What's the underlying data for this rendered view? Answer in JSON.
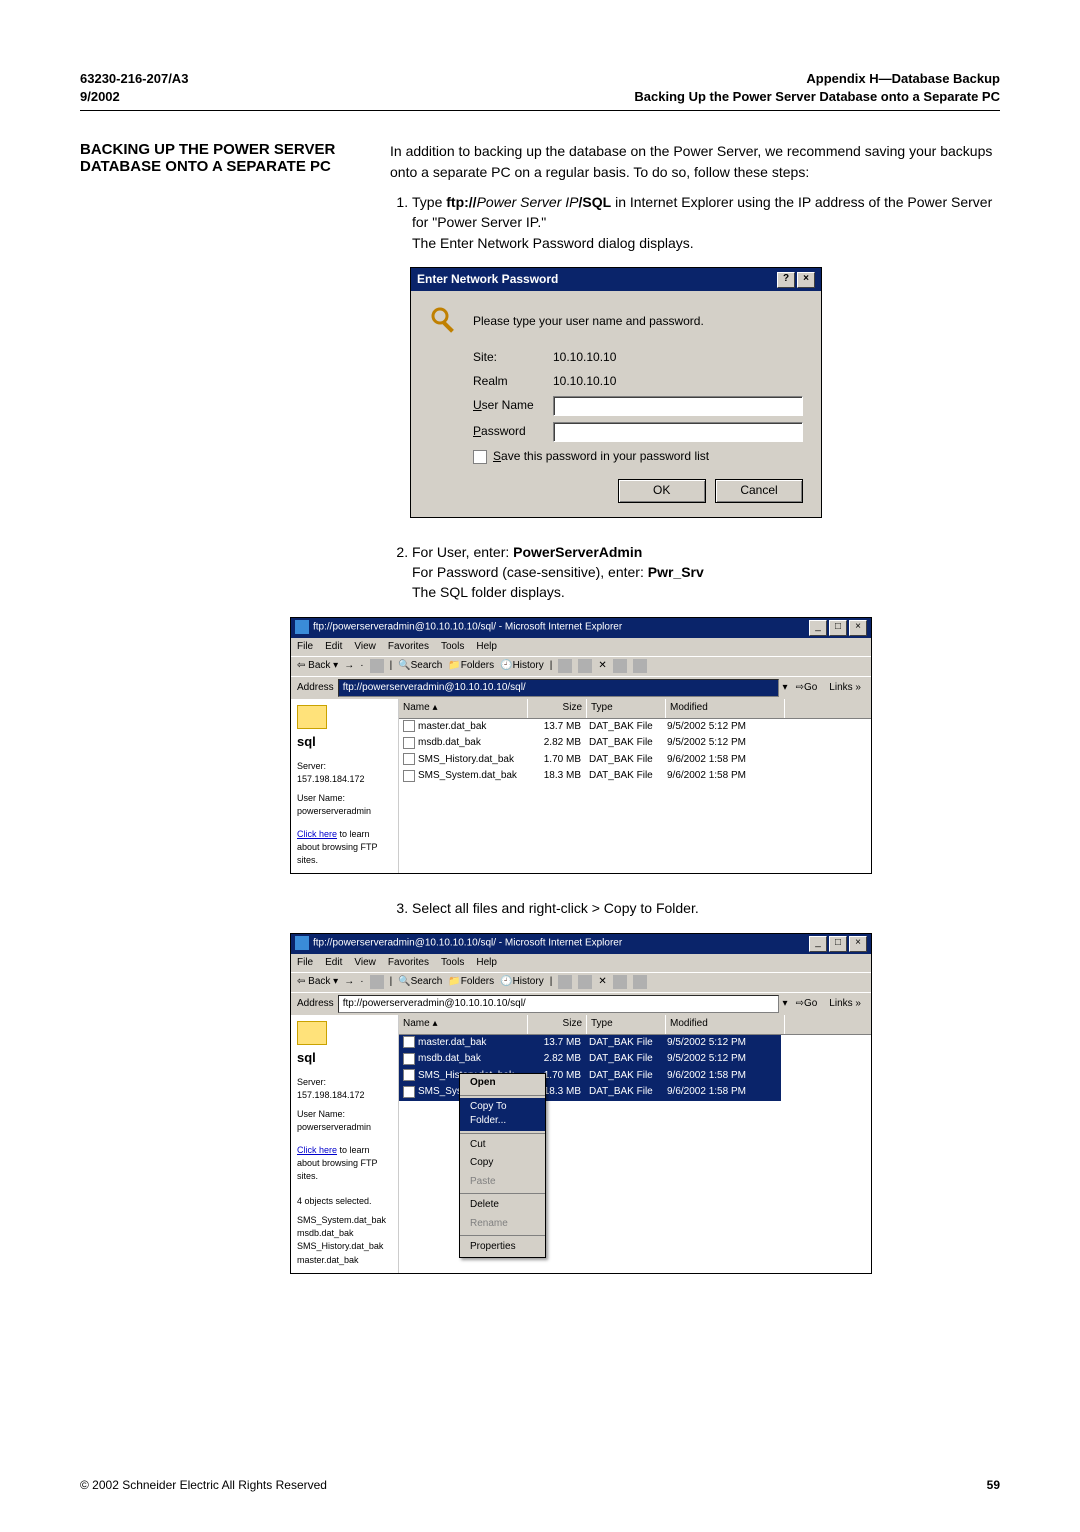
{
  "header": {
    "doc_number": "63230-216-207/A3",
    "date": "9/2002",
    "appendix": "Appendix H—Database Backup",
    "subtitle": "Backing Up the Power Server Database onto a Separate PC"
  },
  "section_title": "BACKING UP THE POWER SERVER DATABASE ONTO A SEPARATE PC",
  "intro": "In addition to backing up the database on the Power Server, we recommend saving your backups onto a separate PC on a regular basis. To do so, follow these steps:",
  "steps": {
    "s1a": "Type ",
    "s1b": "ftp://",
    "s1c": "Power Server IP",
    "s1d": "/SQL",
    "s1e": " in Internet Explorer using the IP address of the Power Server for \"Power Server IP.\"",
    "s1f": "The Enter Network Password dialog displays.",
    "s2a": "For User, enter: ",
    "s2b": "PowerServerAdmin",
    "s2c": "For Password (case-sensitive), enter: ",
    "s2d": "Pwr_Srv",
    "s2e": "The SQL folder displays.",
    "s3": "Select all files and right-click > Copy to Folder."
  },
  "dialog": {
    "title": "Enter Network Password",
    "prompt": "Please type your user name and password.",
    "site_lbl": "Site:",
    "site_val": "10.10.10.10",
    "realm_lbl": "Realm",
    "realm_val": "10.10.10.10",
    "user_lbl": "User Name",
    "pass_lbl": "Password",
    "save_lbl": "Save this password in your password list",
    "ok": "OK",
    "cancel": "Cancel"
  },
  "ie1": {
    "title": "ftp://powerserveradmin@10.10.10.10/sql/ - Microsoft Internet Explorer",
    "menus": [
      "File",
      "Edit",
      "View",
      "Favorites",
      "Tools",
      "Help"
    ],
    "back": "Back",
    "search": "Search",
    "folders": "Folders",
    "history": "History",
    "addr_lbl": "Address",
    "addr_val": "ftp://powerserveradmin@10.10.10.10/sql/",
    "go": "Go",
    "links": "Links",
    "sql": "sql",
    "server_line": "Server: 157.198.184.172",
    "user_line": "User Name: powerserveradmin",
    "click_here": "Click here",
    "browse_text": " to learn about browsing FTP sites.",
    "cols": {
      "name": "Name",
      "size": "Size",
      "type": "Type",
      "mod": "Modified"
    },
    "files": [
      {
        "name": "master.dat_bak",
        "size": "13.7 MB",
        "type": "DAT_BAK File",
        "mod": "9/5/2002 5:12 PM"
      },
      {
        "name": "msdb.dat_bak",
        "size": "2.82 MB",
        "type": "DAT_BAK File",
        "mod": "9/5/2002 5:12 PM"
      },
      {
        "name": "SMS_History.dat_bak",
        "size": "1.70 MB",
        "type": "DAT_BAK File",
        "mod": "9/6/2002 1:58 PM"
      },
      {
        "name": "SMS_System.dat_bak",
        "size": "18.3 MB",
        "type": "DAT_BAK File",
        "mod": "9/6/2002 1:58 PM"
      }
    ]
  },
  "ie2": {
    "addr_val": "ftp://powerserveradmin@10.10.10.10/sql/",
    "selected_info": "4 objects selected.",
    "sel_files": [
      "SMS_System.dat_bak",
      "msdb.dat_bak",
      "SMS_History.dat_bak",
      "master.dat_bak"
    ],
    "menu": {
      "open": "Open",
      "copy_to": "Copy To Folder...",
      "cut": "Cut",
      "copy": "Copy",
      "paste": "Paste",
      "delete": "Delete",
      "rename": "Rename",
      "props": "Properties"
    }
  },
  "footer": {
    "copyright": "© 2002 Schneider Electric  All Rights Reserved",
    "page": "59"
  }
}
